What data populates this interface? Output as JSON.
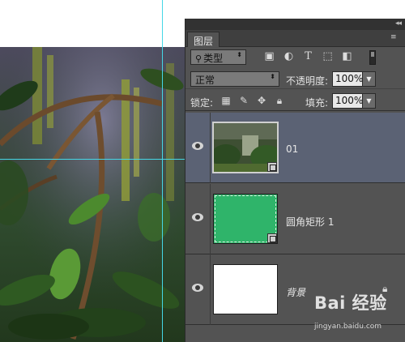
{
  "panel": {
    "tab_label": "图层",
    "filter": {
      "kind_label": "类型"
    },
    "blend": {
      "mode": "正常",
      "opacity_label": "不透明度:",
      "opacity_value": "100%"
    },
    "lock": {
      "label": "锁定:",
      "fill_label": "填充:",
      "fill_value": "100%"
    }
  },
  "layers": [
    {
      "name": "01",
      "selected": true,
      "visible": true
    },
    {
      "name": "圆角矩形 1",
      "selected": false,
      "visible": true,
      "fill_color": "#2fb46a"
    },
    {
      "name": "背景",
      "selected": false,
      "visible": true,
      "fill_color": "#ffffff",
      "locked": true
    }
  ],
  "colors": {
    "panel_bg": "#535353",
    "selected_layer": "#5b6274",
    "guide": "#45d7e6"
  },
  "watermark": {
    "logo": "Bai 经验",
    "site": "jingyan.baidu.com"
  }
}
